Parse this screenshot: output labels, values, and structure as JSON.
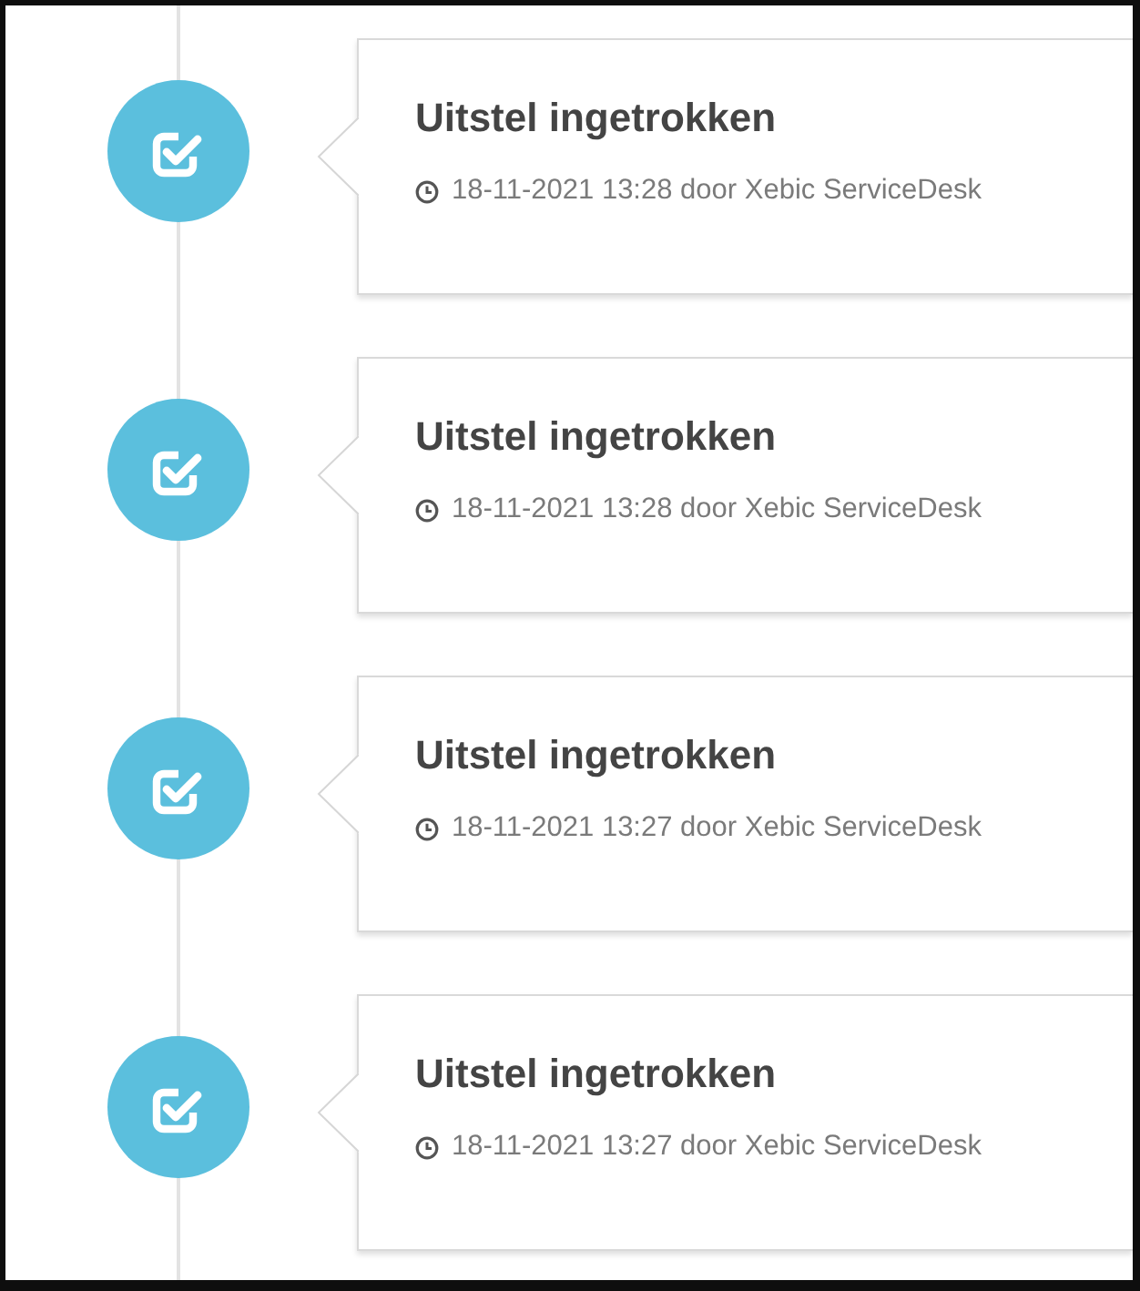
{
  "timeline": [
    {
      "title": "Uitstel ingetrokken",
      "meta": "18-11-2021 13:28 door Xebic ServiceDesk"
    },
    {
      "title": "Uitstel ingetrokken",
      "meta": "18-11-2021 13:28 door Xebic ServiceDesk"
    },
    {
      "title": "Uitstel ingetrokken",
      "meta": "18-11-2021 13:27 door Xebic ServiceDesk"
    },
    {
      "title": "Uitstel ingetrokken",
      "meta": "18-11-2021 13:27 door Xebic ServiceDesk"
    }
  ]
}
